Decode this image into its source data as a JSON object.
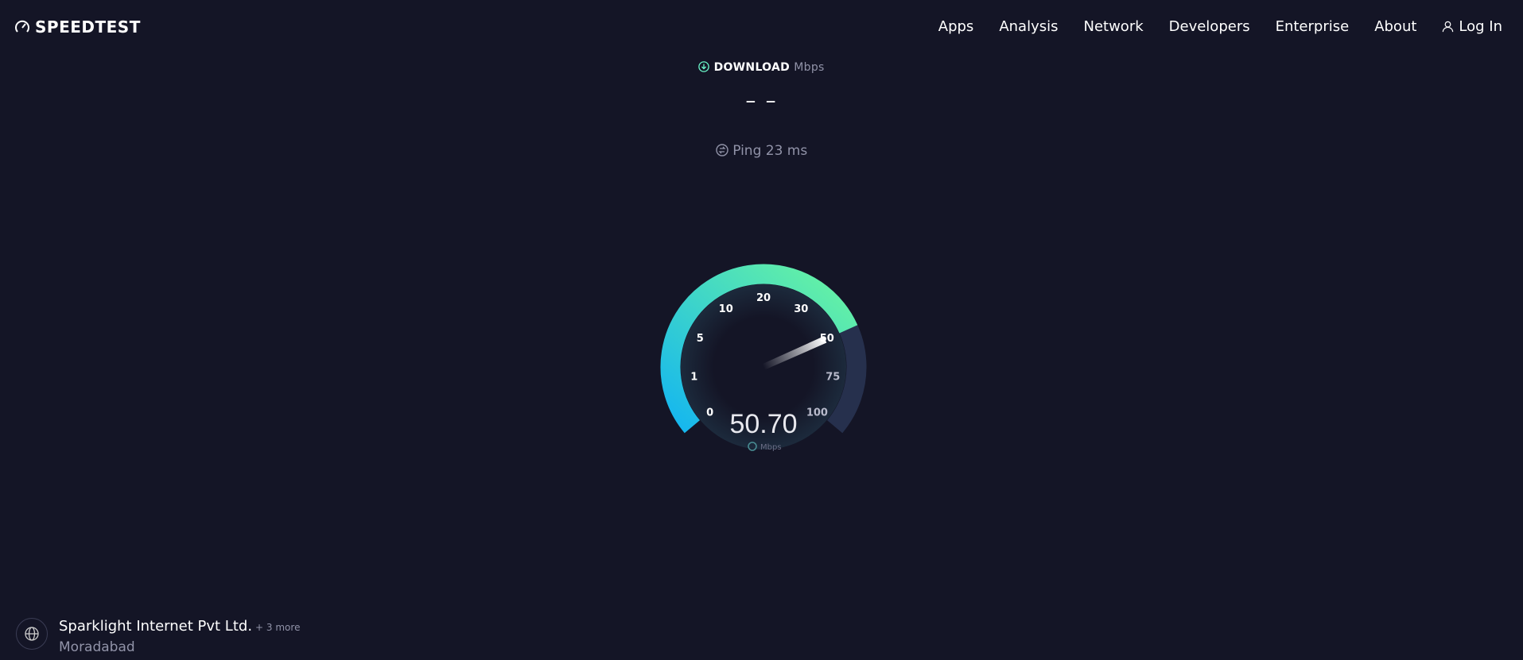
{
  "header": {
    "logo": "SPEEDTEST",
    "nav": [
      "Apps",
      "Analysis",
      "Network",
      "Developers",
      "Enterprise",
      "About"
    ],
    "login": "Log In"
  },
  "download": {
    "label": "DOWNLOAD",
    "unit": "Mbps",
    "value": "– –"
  },
  "ping": {
    "label": "Ping 23 ms"
  },
  "gauge": {
    "ticks": [
      "0",
      "1",
      "5",
      "10",
      "20",
      "30",
      "50",
      "75",
      "100"
    ],
    "reading": "50.70",
    "unit": "Mbps",
    "fill_tick_position": 6.03,
    "colors": {
      "start": "#14b6f0",
      "end": "#6af5a0",
      "track": "#26304d"
    }
  },
  "server": {
    "isp": "Sparklight Internet Pvt Ltd.",
    "more": "+ 3 more",
    "city": "Moradabad"
  }
}
